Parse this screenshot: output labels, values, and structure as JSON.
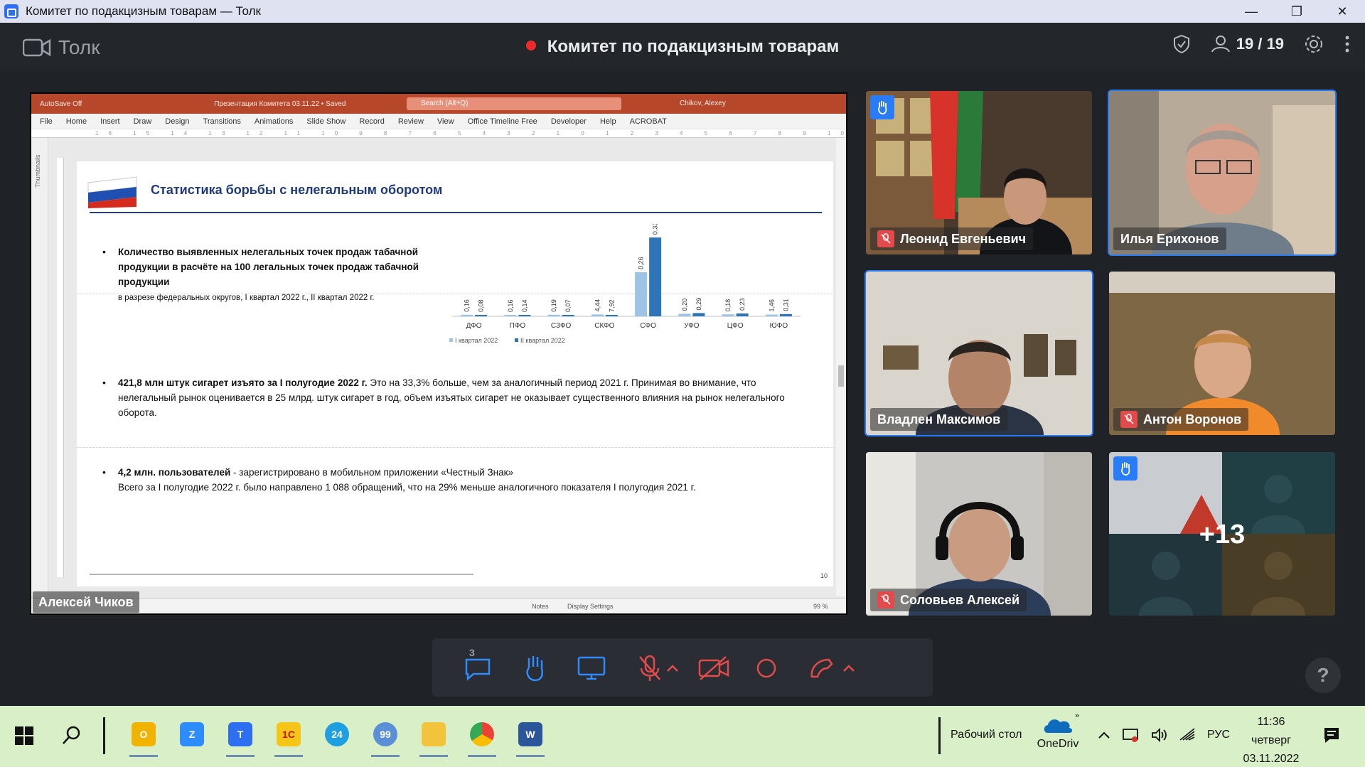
{
  "window": {
    "title": "Комитет по подакцизным товарам — Толк"
  },
  "app": {
    "brand": "Толк",
    "meeting_title": "Комитет по подакцизным товарам",
    "participants": "19 / 19"
  },
  "ppt": {
    "autosave": "AutoSave  Off",
    "doc_title": "Презентация Комитета 03.11.22 • Saved",
    "search": "Search (Alt+Q)",
    "user": "Chikov, Alexey",
    "menu": [
      "File",
      "Home",
      "Insert",
      "Draw",
      "Design",
      "Transitions",
      "Animations",
      "Slide Show",
      "Record",
      "Review",
      "View",
      "Office Timeline Free",
      "Developer",
      "Help",
      "ACROBAT"
    ],
    "ruler": "16 15 14 13 12 11 10 9 8 7 6 5 4 3 2 1 0 1 2 3 4 5 6 7 8 9 10 11 12 13 14 15 16",
    "thumbnails": "Thumbnails",
    "status_notes": "Notes",
    "status_display": "Display Settings",
    "status_zoom": "99 %"
  },
  "slide": {
    "title": "Статистика борьбы с нелегальным оборотом",
    "b1_bold": "Количество выявленных нелегальных точек продаж табачной продукции в расчёте на 100 легальных точек продаж табачной продукции",
    "b1_sub": "в разрезе федеральных округов, I квартал 2022 г., II квартал 2022 г.",
    "b2_bold": "421,8 млн штук сигарет изъято за I полугодие 2022 г.",
    "b2_text": " Это на 33,3% больше, чем за аналогичный период 2021 г. Принимая во внимание, что нелегальный рынок оценивается в 25 млрд. штук сигарет в год, объем изъятых сигарет не оказывает существенного влияния на рынок нелегального оборота.",
    "b3_bold": "4,2 млн. пользователей",
    "b3_text": " - зарегистрировано в мобильном приложении «Честный Знак»",
    "b3_line2": "Всего за I полугодие 2022 г. было направлено 1 088 обращений, что на 29% меньше аналогичного показателя I полугодия 2021 г.",
    "page_number": "10"
  },
  "chart_data": {
    "type": "bar",
    "categories": [
      "ДФО",
      "ПФО",
      "СЗФО",
      "СКФО",
      "СФО",
      "УФО",
      "ЦФО",
      "ЮФО"
    ],
    "series": [
      {
        "name": "I квартал 2022",
        "values": [
          0.16,
          0.08,
          0.16,
          0.19,
          4.44,
          0.26,
          0.2,
          0.18
        ],
        "color": "#9dc3e6"
      },
      {
        "name": "II квартал 2022",
        "values": [
          0.0,
          0.14,
          0.07,
          0.07,
          7.92,
          0.33,
          0.29,
          0.23
        ],
        "color": "#2e75b6"
      }
    ],
    "value_labels": [
      [
        "0,16",
        "0,08"
      ],
      [
        "0,16",
        "0,14"
      ],
      [
        "0,19",
        "0,07"
      ],
      [
        "4,44",
        "7,92"
      ],
      [
        "0,26",
        "0,33"
      ],
      [
        "0,20",
        "0,29"
      ],
      [
        "0,18",
        "0,23"
      ],
      [
        "1,46",
        "0,31"
      ]
    ],
    "ylim": [
      0,
      8
    ],
    "legend": "bottom"
  },
  "presenter": "Алексей Чиков",
  "tiles": [
    {
      "name": "Леонид Евгеньевич",
      "muted": true,
      "hand": true
    },
    {
      "name": "Илья Ерихонов",
      "muted": false,
      "hand": false,
      "active": true
    },
    {
      "name": "Владлен Максимов",
      "muted": false,
      "hand": false,
      "active": true
    },
    {
      "name": "Антон Воронов",
      "muted": true,
      "hand": false
    },
    {
      "name": "Соловьев Алексей",
      "muted": true,
      "hand": false
    },
    {
      "name": "+13",
      "muted": false,
      "hand": true
    }
  ],
  "controls": {
    "chat_badge": "3",
    "help": "?"
  },
  "taskbar": {
    "desktop_label": "Рабочий стол",
    "onedrive_label": "OneDriv",
    "lang": "РУС",
    "time": "11:36",
    "day": "четверг",
    "date": "03.11.2022"
  },
  "colors": {
    "accent": "#2a7cf6",
    "record": "#ee2b2b",
    "ppt_red": "#b7472a",
    "mute": "#e24b4b",
    "taskbar": "#d9efc7"
  }
}
